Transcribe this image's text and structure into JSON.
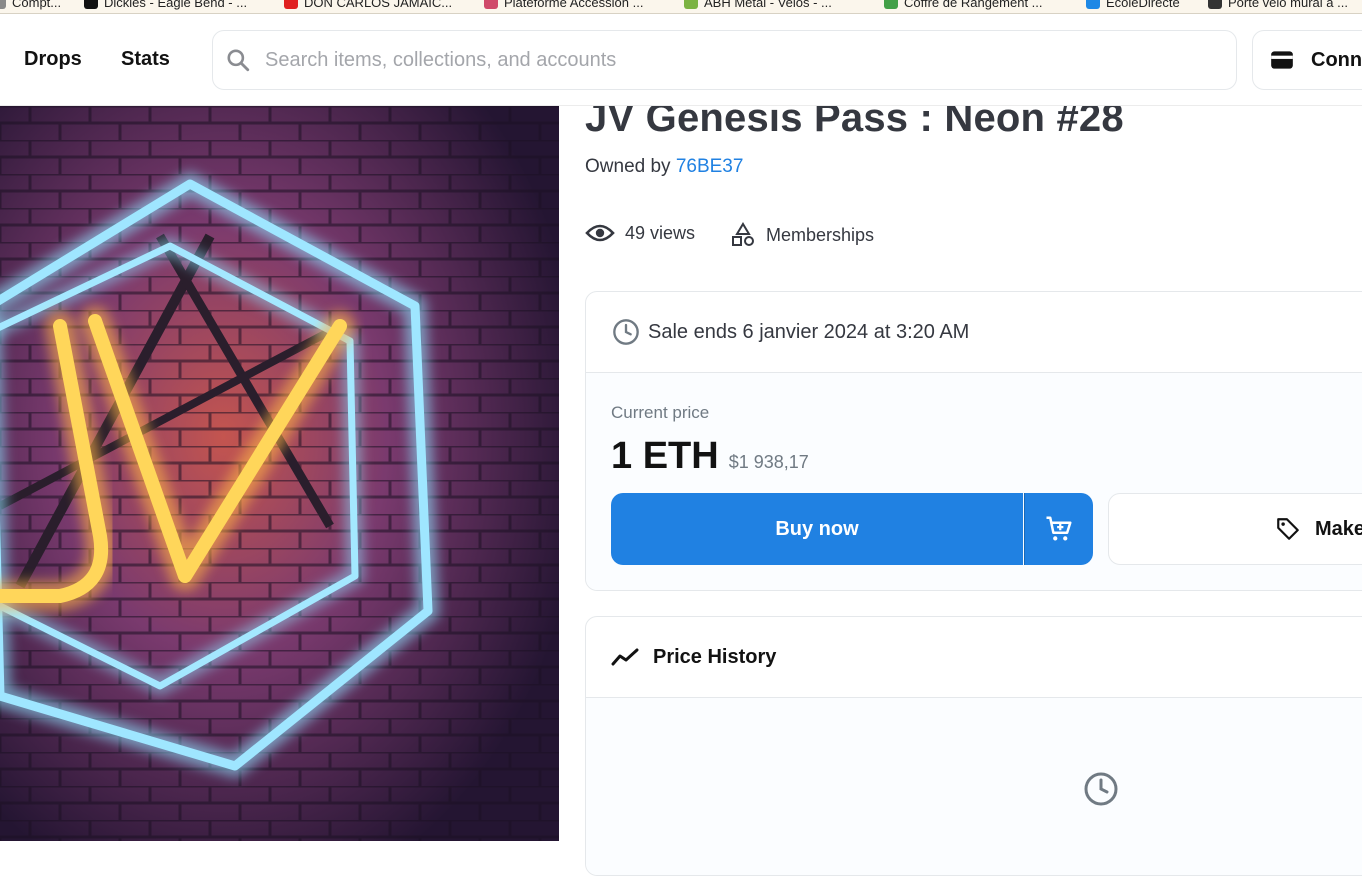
{
  "bookmarks": [
    {
      "label": "Compt...",
      "color": "#8a8a8a"
    },
    {
      "label": "Dickies - Eagle Bend - ...",
      "color": "#111111"
    },
    {
      "label": "DON CARLOS JAMAIC...",
      "color": "#e02020"
    },
    {
      "label": "Plateforme Accession ...",
      "color": "#d04a6a"
    },
    {
      "label": "ABH Metal - Velos - ...",
      "color": "#7cb342"
    },
    {
      "label": "Coffre de Rangement ...",
      "color": "#43a047"
    },
    {
      "label": "EcoleDirecte",
      "color": "#1e88e5"
    },
    {
      "label": "Porte velo mural a ...",
      "color": "#333333"
    }
  ],
  "nav": {
    "drops": "Drops",
    "stats": "Stats",
    "search_placeholder": "Search items, collections, and accounts",
    "connect": "Conn"
  },
  "artwork": {
    "alt_icon": "nft-artwork-image",
    "letters": "JV"
  },
  "item": {
    "title": "JV Genesis Pass : Neon #28",
    "owned_by_label": "Owned by",
    "owner": "76BE37",
    "views": "49 views",
    "category": "Memberships"
  },
  "sale": {
    "ends_text": "Sale ends 6 janvier 2024 at 3:20 AM",
    "current_price_label": "Current price",
    "price_eth": "1 ETH",
    "price_usd": "$1 938,17",
    "buy_label": "Buy now",
    "offer_label": "Make"
  },
  "price_history": {
    "title": "Price History"
  },
  "colors": {
    "accent": "#2081e2",
    "text_primary": "#353840",
    "text_secondary": "#707a83",
    "border": "#e5e8eb"
  }
}
